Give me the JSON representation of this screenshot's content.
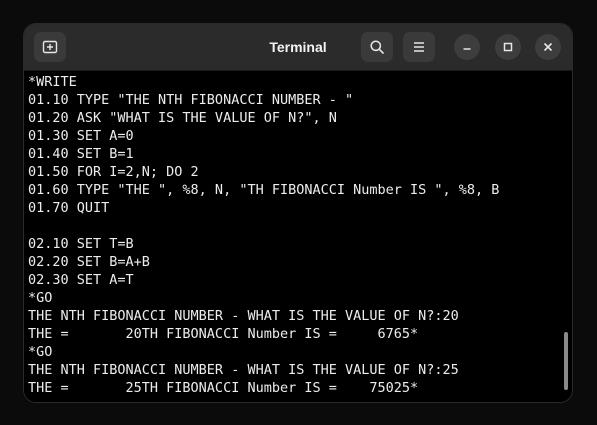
{
  "window": {
    "title": "Terminal"
  },
  "titlebar": {
    "new_tab_icon": "new-tab-icon",
    "search_icon": "search-icon",
    "menu_icon": "hamburger-menu-icon",
    "minimize_icon": "minimize-icon",
    "maximize_icon": "maximize-icon",
    "close_icon": "close-icon"
  },
  "terminal": {
    "lines": [
      "*WRITE",
      "01.10 TYPE \"THE NTH FIBONACCI NUMBER - \"",
      "01.20 ASK \"WHAT IS THE VALUE OF N?\", N",
      "01.30 SET A=0",
      "01.40 SET B=1",
      "01.50 FOR I=2,N; DO 2",
      "01.60 TYPE \"THE \", %8, N, \"TH FIBONACCI Number IS \", %8, B",
      "01.70 QUIT",
      "",
      "02.10 SET T=B",
      "02.20 SET B=A+B",
      "02.30 SET A=T",
      "*GO",
      "THE NTH FIBONACCI NUMBER - WHAT IS THE VALUE OF N?:20",
      "THE =       20TH FIBONACCI Number IS =     6765*",
      "*GO",
      "THE NTH FIBONACCI NUMBER - WHAT IS THE VALUE OF N?:25",
      "THE =       25TH FIBONACCI Number IS =    75025*"
    ]
  },
  "colors": {
    "background": "#000000",
    "text": "#ededed",
    "titlebar": "#2b2b2b"
  }
}
